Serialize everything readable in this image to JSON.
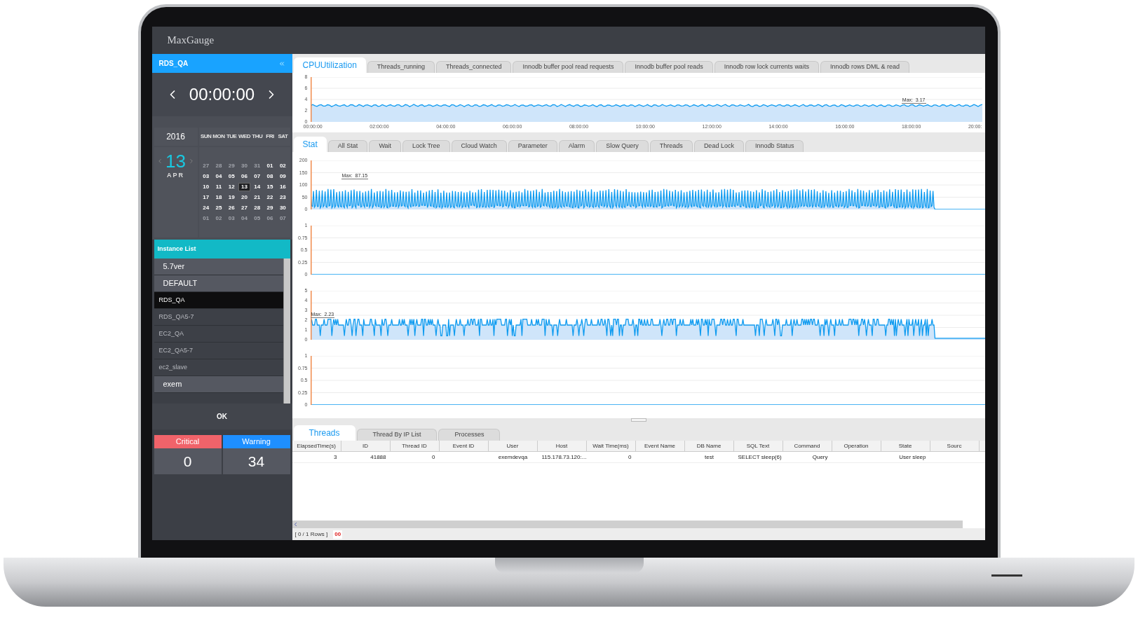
{
  "window": {
    "title": "MaxGauge"
  },
  "sidebar": {
    "instance": "RDS_QA",
    "time": "00:00:00",
    "calendar": {
      "year": "2016",
      "day": "13",
      "month": "APR",
      "weekdays": [
        "SUN",
        "MON",
        "TUE",
        "WED",
        "THU",
        "FRI",
        "SAT"
      ],
      "days": [
        {
          "d": "27",
          "outside": true,
          "selected": false
        },
        {
          "d": "28",
          "outside": true,
          "selected": false
        },
        {
          "d": "29",
          "outside": true,
          "selected": false
        },
        {
          "d": "30",
          "outside": true,
          "selected": false
        },
        {
          "d": "31",
          "outside": true,
          "selected": false
        },
        {
          "d": "01",
          "outside": false,
          "selected": false
        },
        {
          "d": "02",
          "outside": false,
          "selected": false
        },
        {
          "d": "03",
          "outside": false,
          "selected": false
        },
        {
          "d": "04",
          "outside": false,
          "selected": false
        },
        {
          "d": "05",
          "outside": false,
          "selected": false
        },
        {
          "d": "06",
          "outside": false,
          "selected": false
        },
        {
          "d": "07",
          "outside": false,
          "selected": false
        },
        {
          "d": "08",
          "outside": false,
          "selected": false
        },
        {
          "d": "09",
          "outside": false,
          "selected": false
        },
        {
          "d": "10",
          "outside": false,
          "selected": false
        },
        {
          "d": "11",
          "outside": false,
          "selected": false
        },
        {
          "d": "12",
          "outside": false,
          "selected": false
        },
        {
          "d": "13",
          "outside": false,
          "selected": true
        },
        {
          "d": "14",
          "outside": false,
          "selected": false
        },
        {
          "d": "15",
          "outside": false,
          "selected": false
        },
        {
          "d": "16",
          "outside": false,
          "selected": false
        },
        {
          "d": "17",
          "outside": false,
          "selected": false
        },
        {
          "d": "18",
          "outside": false,
          "selected": false
        },
        {
          "d": "19",
          "outside": false,
          "selected": false
        },
        {
          "d": "20",
          "outside": false,
          "selected": false
        },
        {
          "d": "21",
          "outside": false,
          "selected": false
        },
        {
          "d": "22",
          "outside": false,
          "selected": false
        },
        {
          "d": "23",
          "outside": false,
          "selected": false
        },
        {
          "d": "24",
          "outside": false,
          "selected": false
        },
        {
          "d": "25",
          "outside": false,
          "selected": false
        },
        {
          "d": "26",
          "outside": false,
          "selected": false
        },
        {
          "d": "27",
          "outside": false,
          "selected": false
        },
        {
          "d": "28",
          "outside": false,
          "selected": false
        },
        {
          "d": "29",
          "outside": false,
          "selected": false
        },
        {
          "d": "30",
          "outside": false,
          "selected": false
        },
        {
          "d": "01",
          "outside": true,
          "selected": false
        },
        {
          "d": "02",
          "outside": true,
          "selected": false
        },
        {
          "d": "03",
          "outside": true,
          "selected": false
        },
        {
          "d": "04",
          "outside": true,
          "selected": false
        },
        {
          "d": "05",
          "outside": true,
          "selected": false
        },
        {
          "d": "06",
          "outside": true,
          "selected": false
        },
        {
          "d": "07",
          "outside": true,
          "selected": false
        }
      ]
    },
    "instance_list": {
      "title": "Instance List",
      "items": [
        {
          "label": "5.7ver",
          "kind": "group",
          "selected": false
        },
        {
          "label": "DEFAULT",
          "kind": "group",
          "selected": false
        },
        {
          "label": "RDS_QA",
          "kind": "instance",
          "selected": true
        },
        {
          "label": "RDS_QA5-7",
          "kind": "instance",
          "selected": false
        },
        {
          "label": "EC2_QA",
          "kind": "instance",
          "selected": false
        },
        {
          "label": "EC2_QA5-7",
          "kind": "instance",
          "selected": false
        },
        {
          "label": "ec2_slave",
          "kind": "instance",
          "selected": false
        },
        {
          "label": "exem",
          "kind": "group",
          "selected": false
        }
      ]
    },
    "ok_button": "OK",
    "alerts": [
      {
        "label": "Critical",
        "count": "0",
        "color": "#f0636a"
      },
      {
        "label": "Warning",
        "count": "34",
        "color": "#1e8fff"
      }
    ]
  },
  "metric_tabs": [
    {
      "label": "CPUUtilization",
      "selected": true
    },
    {
      "label": "Threads_running",
      "selected": false
    },
    {
      "label": "Threads_connected",
      "selected": false
    },
    {
      "label": "Innodb buffer pool read requests",
      "selected": false
    },
    {
      "label": "Innodb buffer pool reads",
      "selected": false
    },
    {
      "label": "Innodb row lock currents waits",
      "selected": false
    },
    {
      "label": "Innodb rows DML & read",
      "selected": false
    }
  ],
  "cpu_chart": {
    "kind": "steady",
    "y_ticks": [
      "8",
      "6",
      "4",
      "2",
      "0"
    ],
    "x_ticks": [
      "00:00:00",
      "02:00:00",
      "04:00:00",
      "06:00:00",
      "08:00:00",
      "10:00:00",
      "12:00:00",
      "14:00:00",
      "16:00:00",
      "18:00:00",
      "20:00:"
    ],
    "max_label": "Max:  3.17"
  },
  "stat_tabs": [
    {
      "label": "Stat",
      "selected": true
    },
    {
      "label": "All Stat",
      "selected": false
    },
    {
      "label": "Wait",
      "selected": false
    },
    {
      "label": "Lock Tree",
      "selected": false
    },
    {
      "label": "Cloud Watch",
      "selected": false
    },
    {
      "label": "Parameter",
      "selected": false
    },
    {
      "label": "Alarm",
      "selected": false
    },
    {
      "label": "Slow Query",
      "selected": false
    },
    {
      "label": "Threads",
      "selected": false
    },
    {
      "label": "Dead Lock",
      "selected": false
    },
    {
      "label": "Innodb Status",
      "selected": false
    }
  ],
  "stat_charts": [
    {
      "kind": "spiky",
      "y_ticks": [
        "200",
        "150",
        "100",
        "50",
        "0"
      ],
      "max_label": "Max:  87.15"
    },
    {
      "kind": "flat",
      "y_ticks": [
        "1",
        "0.75",
        "0.5",
        "0.25",
        "0"
      ]
    },
    {
      "kind": "busy",
      "y_ticks": [
        "5",
        "4",
        "3",
        "2",
        "1",
        "0"
      ],
      "max_label": "Max:  2.23"
    },
    {
      "kind": "flat",
      "y_ticks": [
        "1",
        "0.75",
        "0.5",
        "0.25",
        "0"
      ]
    }
  ],
  "bottom_tabs": [
    {
      "label": "Threads",
      "selected": true
    },
    {
      "label": "Thread By IP List",
      "selected": false
    },
    {
      "label": "Processes",
      "selected": false
    }
  ],
  "table": {
    "columns": [
      "ElapsedTime(s)",
      "ID",
      "Thread ID",
      "Event ID",
      "User",
      "Host",
      "Wait Time(ms)",
      "Event Name",
      "DB Name",
      "SQL Text",
      "Command",
      "Operation",
      "State",
      "Sourc"
    ],
    "rows": [
      {
        "cells": [
          "3",
          "41888",
          "0",
          null,
          "exemdevqa",
          "115.178.73.120:...",
          "0",
          null,
          "test",
          "SELECT sleep(6)",
          "Query",
          null,
          "User sleep",
          null
        ]
      }
    ]
  },
  "status_bar": {
    "rows": "[ 0 / 1 Rows ]",
    "code": "00"
  }
}
